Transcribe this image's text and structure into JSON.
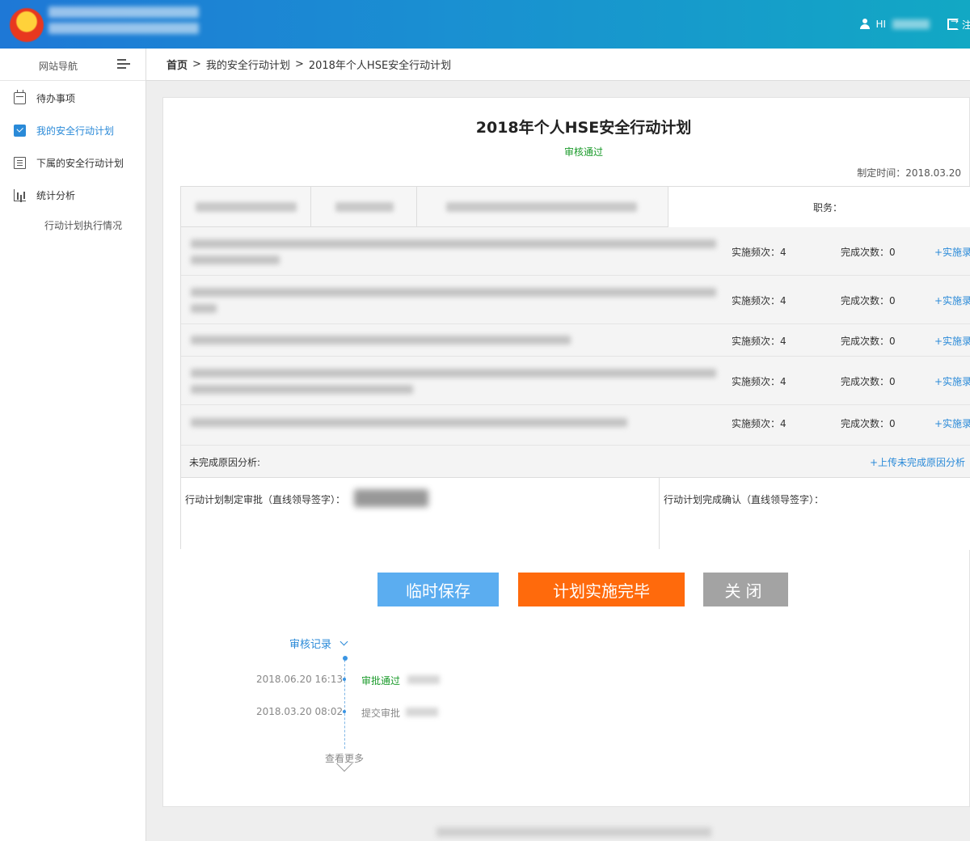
{
  "header": {
    "greeting": "HI",
    "logout_label": "注"
  },
  "sidebar": {
    "title": "网站导航",
    "items": [
      {
        "label": "待办事项"
      },
      {
        "label": "我的安全行动计划"
      },
      {
        "label": "下属的安全行动计划"
      },
      {
        "label": "统计分析"
      }
    ],
    "sub_items": [
      {
        "label": "行动计划执行情况"
      }
    ]
  },
  "breadcrumb": {
    "home": "首页",
    "separator": ">",
    "level1": "我的安全行动计划",
    "level2": "2018年个人HSE安全行动计划"
  },
  "plan": {
    "title": "2018年个人HSE安全行动计划",
    "status": "审核通过",
    "created": "制定时间：2018.03.20",
    "duty_label": "职务："
  },
  "rows": [
    {
      "freq": "实施频次：4",
      "done": "完成次数：0",
      "add": "+实施录"
    },
    {
      "freq": "实施频次：4",
      "done": "完成次数：0",
      "add": "+实施录"
    },
    {
      "freq": "实施频次：4",
      "done": "完成次数：0",
      "add": "+实施录"
    },
    {
      "freq": "实施频次：4",
      "done": "完成次数：0",
      "add": "+实施录"
    },
    {
      "freq": "实施频次：4",
      "done": "完成次数：0",
      "add": "+实施录"
    }
  ],
  "reason": {
    "label": "未完成原因分析:",
    "upload": "+上传未完成原因分析"
  },
  "sign": {
    "approve_label": "行动计划制定审批（直线领导签字）：",
    "confirm_label": "行动计划完成确认（直线领导签字）："
  },
  "buttons": {
    "save": "临时保存",
    "complete": "计划实施完毕",
    "close": "关闭"
  },
  "audit": {
    "title": "审核记录",
    "records": [
      {
        "time": "2018.06.20 16:13",
        "action": "审批通过"
      },
      {
        "time": "2018.03.20 08:02",
        "action": "提交审批"
      }
    ],
    "more": "查看更多"
  },
  "colors": {
    "accent": "#2a8ad8",
    "success": "#1a9a2a",
    "save_btn": "#5badf0",
    "complete_btn": "#ff6a0c",
    "close_btn": "#a3a3a3"
  }
}
